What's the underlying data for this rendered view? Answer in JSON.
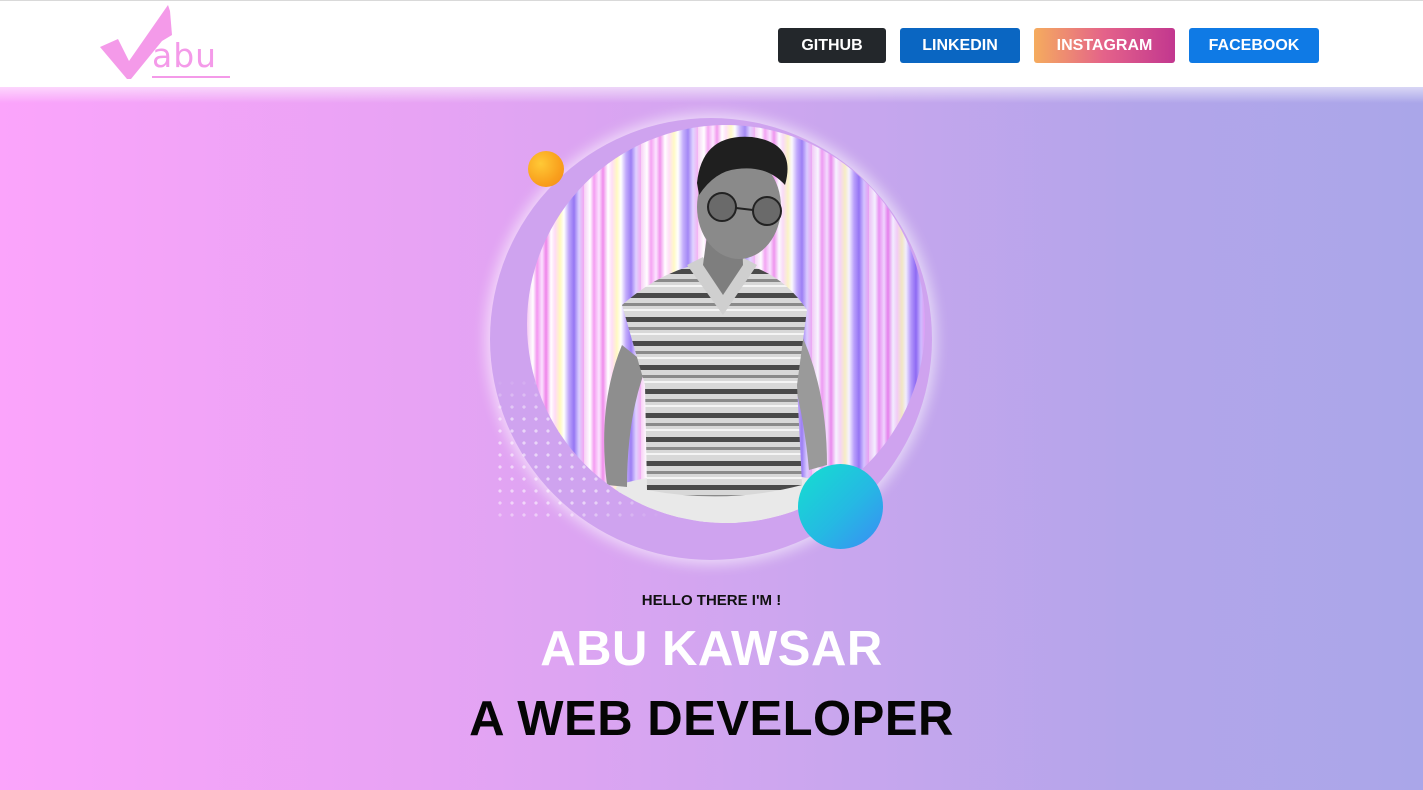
{
  "header": {
    "logo": {
      "text": "abu",
      "color": "#f49ae9",
      "icon": "checkmark-icon"
    },
    "nav": [
      {
        "label": "GITHUB",
        "color": "#23272b"
      },
      {
        "label": "LINKEDIN",
        "color": "#0a66c2"
      },
      {
        "label": "INSTAGRAM",
        "color": "#e4628a"
      },
      {
        "label": "FACEBOOK",
        "color": "#0f7ae5"
      }
    ]
  },
  "hero": {
    "greeting": "HELLO THERE I'M !",
    "name": "ABU KAWSAR",
    "role": "A WEB DEVELOPER",
    "photo": "profile-photo",
    "accent_colors": {
      "orange_orb": "#f9a01d",
      "teal_orb": "#25b9e3",
      "ring": "#cfa3ef"
    }
  }
}
